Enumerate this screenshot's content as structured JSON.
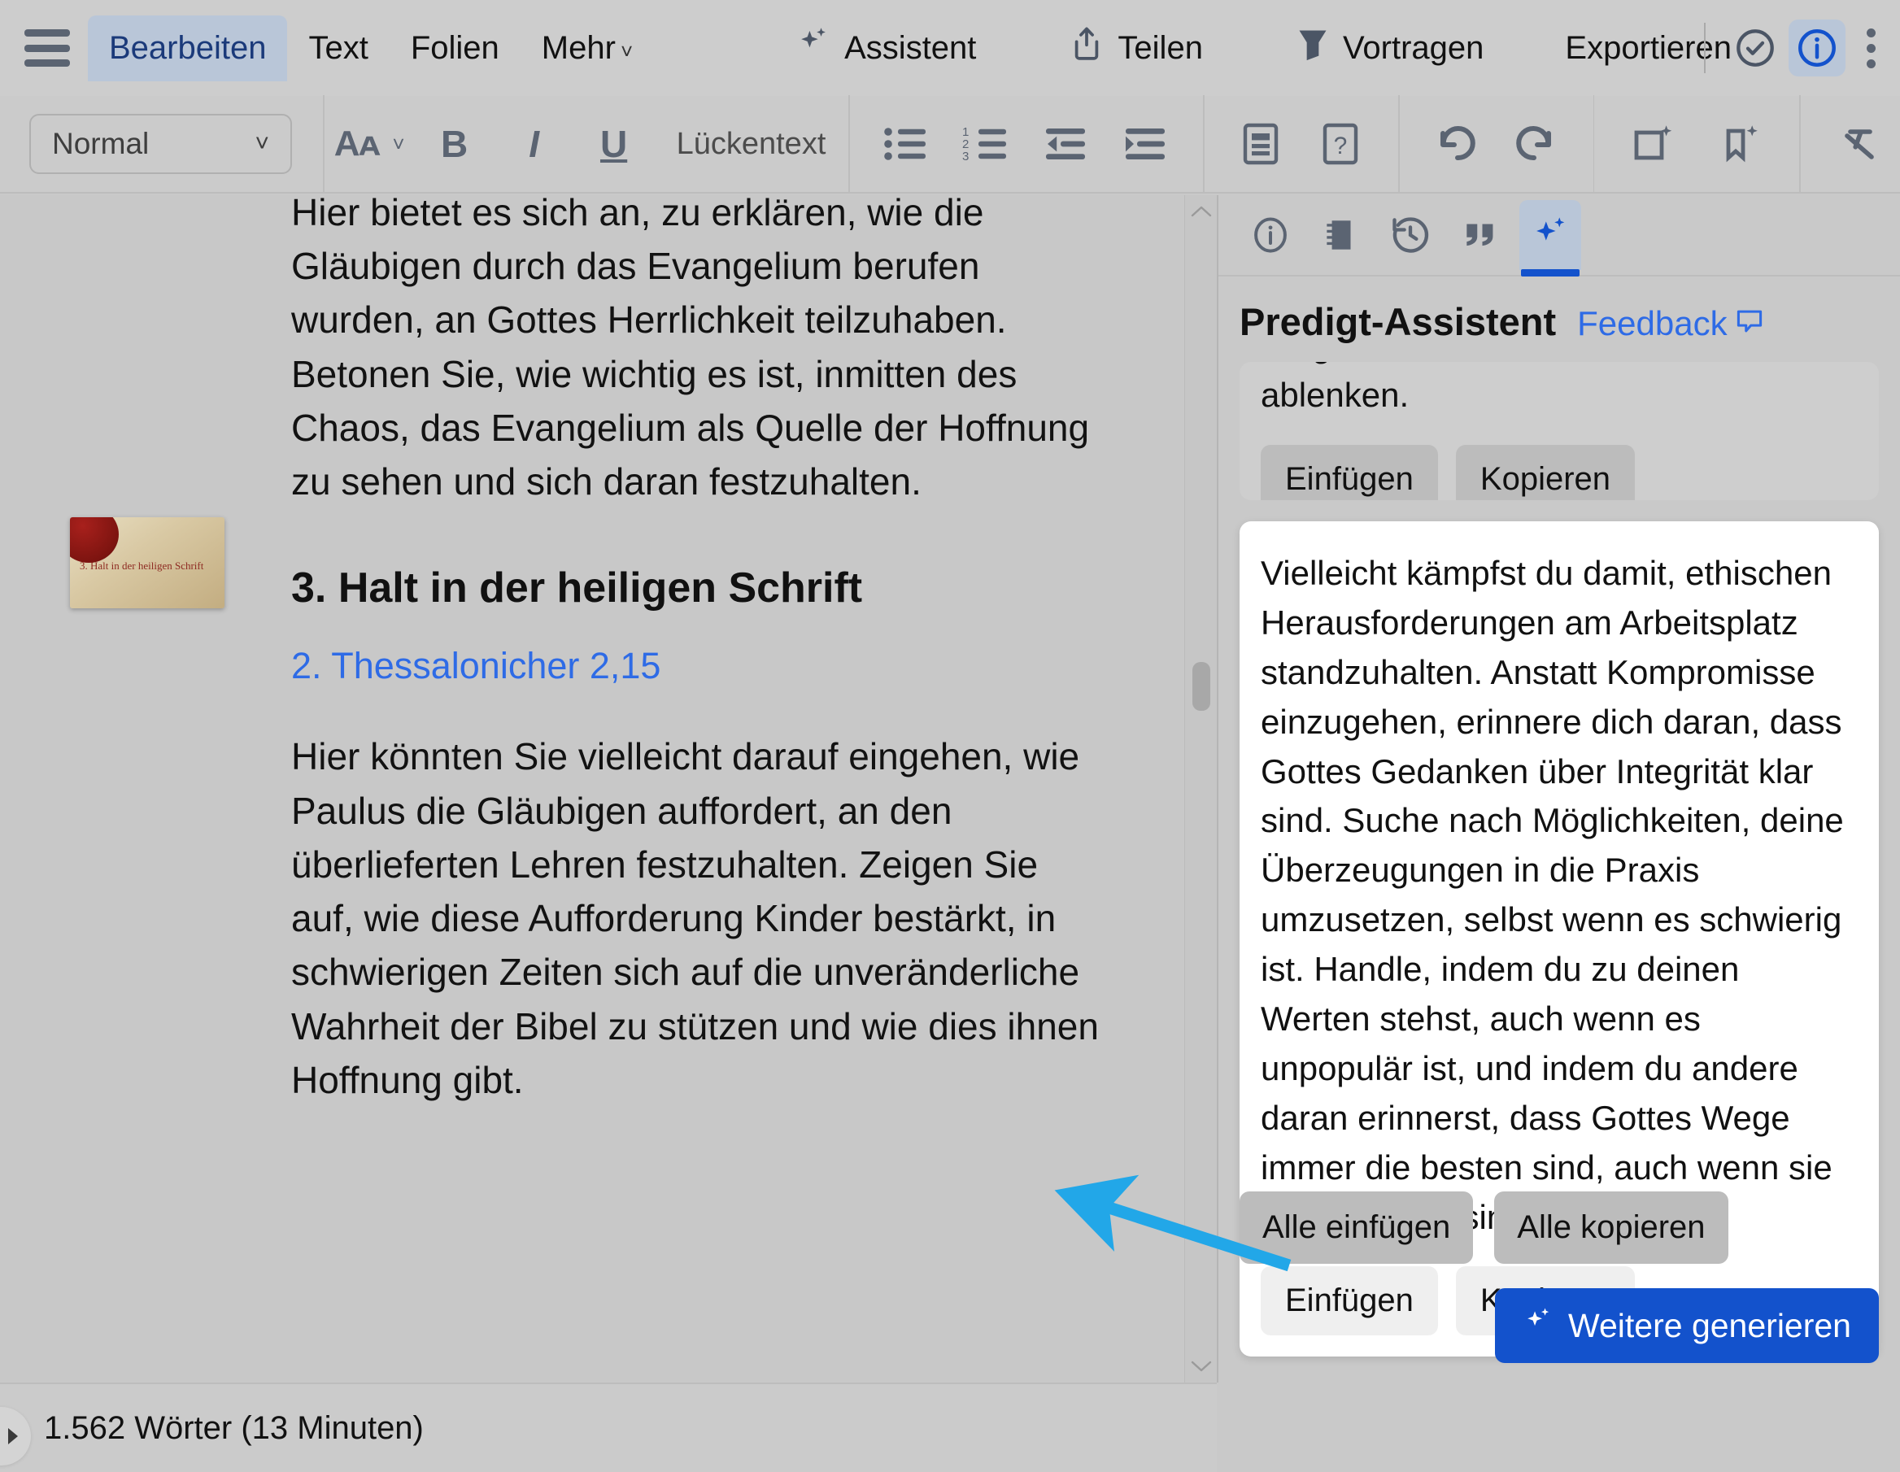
{
  "topbar": {
    "menu_icon": "hamburger-icon",
    "tabs": [
      {
        "label": "Bearbeiten",
        "active": true
      },
      {
        "label": "Text",
        "active": false
      },
      {
        "label": "Folien",
        "active": false
      },
      {
        "label": "Mehr",
        "active": false,
        "chevron": "˅"
      }
    ],
    "actions": [
      {
        "label": "Assistent",
        "icon": "sparkle-icon"
      },
      {
        "label": "Teilen",
        "icon": "share-upload-icon"
      },
      {
        "label": "Vortragen",
        "icon": "present-funnel-icon"
      },
      {
        "label": "Exportieren",
        "icon": ""
      }
    ],
    "right_icons": [
      {
        "name": "check-circle-icon",
        "highlight": false
      },
      {
        "name": "info-circle-icon",
        "highlight": true
      },
      {
        "name": "kebab-menu-icon",
        "highlight": false
      }
    ]
  },
  "formatbar": {
    "style_value": "Normal",
    "style_chevron": "˅",
    "font_size_label": "Aᴀ",
    "bold_label": "B",
    "italic_label": "I",
    "underline_label": "U",
    "blank_text_label": "Lückentext",
    "icons": [
      "bulleted-list-icon",
      "numbered-list-icon",
      "outdent-icon",
      "indent-icon",
      "page-layout-icon",
      "help-question-icon",
      "undo-icon",
      "redo-icon",
      "add-slide-sparkle-icon",
      "bookmark-sparkle-icon",
      "clear-format-icon"
    ]
  },
  "document": {
    "paragraph_clipped": "Hier bietet es sich an, zu erklären, wie die Gläubigen durch das Evangelium berufen wurden, an Gottes Herrlichkeit teilzuhaben. Betonen Sie, wie wichtig es ist, inmitten des Chaos, das Evangelium als Quelle der Hoffnung zu sehen und sich daran festzuhalten.",
    "heading": "3. Halt in der heiligen Schrift",
    "slide_thumb_caption": "3. Halt in der heiligen Schrift",
    "scripture_ref": "2. Thessalonicher 2,15",
    "paragraph_2": "Hier könnten Sie vielleicht darauf eingehen, wie Paulus die Gläubigen auffordert, an den überlieferten Lehren festzuhalten. Zeigen Sie auf, wie diese Aufforderung Kinder bestärkt, in schwierigen Zeiten sich auf die unveränderliche Wahrheit der Bibel zu stützen und wie dies ihnen Hoffnung gibt."
  },
  "panel": {
    "tabs": [
      {
        "name": "info-circle-icon",
        "active": false
      },
      {
        "name": "notebook-icon",
        "active": false
      },
      {
        "name": "history-clock-icon",
        "active": false
      },
      {
        "name": "quote-icon",
        "active": false
      },
      {
        "name": "sparkle-icon",
        "active": true
      }
    ],
    "title": "Predigt-Assistent",
    "feedback_label": "Feedback",
    "feedback_icon": "comment-icon",
    "suggestions": [
      {
        "text": "Dingen, die dich von seiner Ruhe ablenken.",
        "insert_label": "Einfügen",
        "copy_label": "Kopieren",
        "highlighted": false
      },
      {
        "text": "Vielleicht kämpfst du damit, ethischen Herausforderungen am Arbeitsplatz standzuhalten. Anstatt Kompromisse einzugehen, erinnere dich daran, dass Gottes Gedanken über Integrität klar sind. Suche nach Möglichkeiten, deine Überzeugungen in die Praxis umzusetzen, selbst wenn es schwierig ist. Handle, indem du zu deinen Werten stehst, auch wenn es unpopulär ist, und indem du andere daran erinnerst, dass Gottes Wege immer die besten sind, auch wenn sie nicht einfach sind.",
        "insert_label": "Einfügen",
        "copy_label": "Kopieren",
        "highlighted": true
      }
    ],
    "insert_all_label": "Alle einfügen",
    "copy_all_label": "Alle kopieren",
    "generate_more_label": "Weitere generieren",
    "generate_more_icon": "sparkle-icon"
  },
  "statusbar": {
    "word_count": "1.562 Wörter (13 Minuten)",
    "collapse_icon": "chevron-right-icon"
  },
  "annotation": {
    "arrow_color": "#22a7e8",
    "points_to": "Einfügen"
  },
  "colors": {
    "accent_blue": "#1352cc",
    "link_blue": "#2e6be6",
    "tab_active_bg": "#b9c6d8",
    "panel_bg": "#c9c9c9",
    "chrome_bg": "#cdcdcd"
  }
}
